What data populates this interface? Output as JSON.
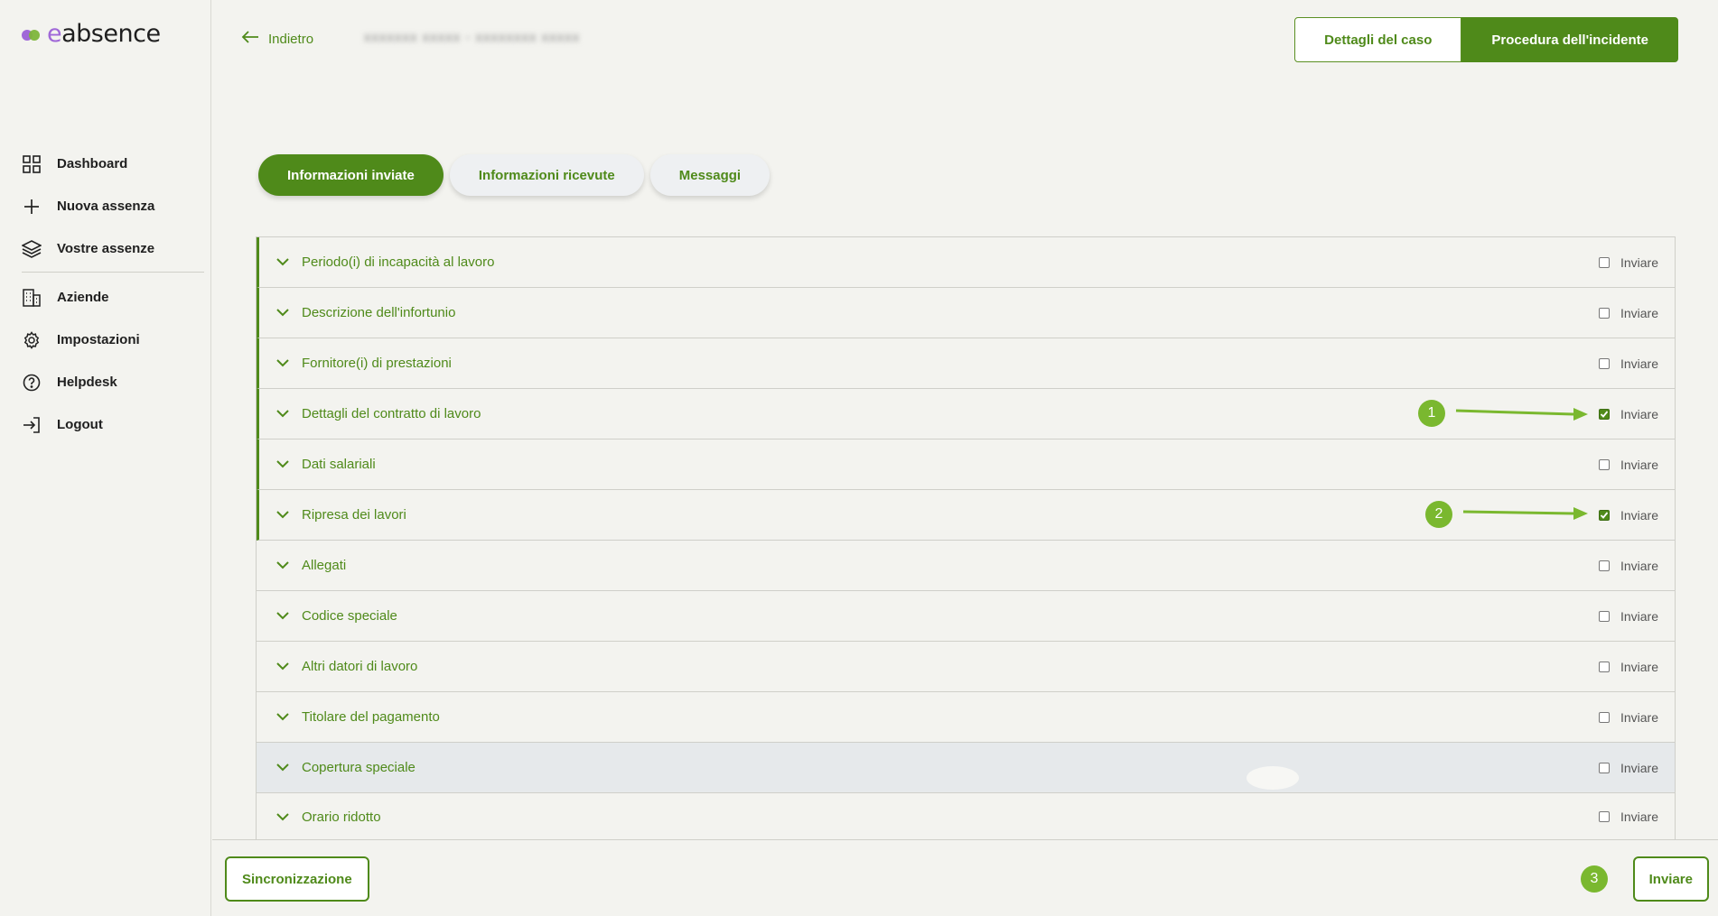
{
  "brand": {
    "name_prefix": "e",
    "name_rest": "absence",
    "accent_green": "#4f8a1a",
    "accent_purple": "#a068d8"
  },
  "sidebar": {
    "items": [
      {
        "label": "Dashboard",
        "icon": "dashboard-grid-icon"
      },
      {
        "label": "Nuova assenza",
        "icon": "plus-icon"
      },
      {
        "label": "Vostre assenze",
        "icon": "layers-icon"
      },
      {
        "label": "Aziende",
        "icon": "building-icon"
      },
      {
        "label": "Impostazioni",
        "icon": "gear-icon"
      },
      {
        "label": "Helpdesk",
        "icon": "help-circle-icon"
      },
      {
        "label": "Logout",
        "icon": "logout-icon"
      }
    ]
  },
  "header": {
    "back_label": "Indietro",
    "case_title": "xxxxxxx xxxxx - xxxxxxxx xxxxx",
    "case_details_label": "Dettagli del caso",
    "incident_procedure_label": "Procedura dell'incidente"
  },
  "tabs": [
    {
      "label": "Informazioni inviate",
      "active": true
    },
    {
      "label": "Informazioni ricevute",
      "active": false
    },
    {
      "label": "Messaggi",
      "active": false
    }
  ],
  "sections": [
    {
      "title": "Periodo(i) di incapacità al lavoro",
      "send_label": "Inviare",
      "checked": false
    },
    {
      "title": "Descrizione dell'infortunio",
      "send_label": "Inviare",
      "checked": false
    },
    {
      "title": "Fornitore(i) di prestazioni",
      "send_label": "Inviare",
      "checked": false
    },
    {
      "title": "Dettagli del contratto di lavoro",
      "send_label": "Inviare",
      "checked": true
    },
    {
      "title": "Dati salariali",
      "send_label": "Inviare",
      "checked": false
    },
    {
      "title": "Ripresa dei lavori",
      "send_label": "Inviare",
      "checked": true
    },
    {
      "title": "Allegati",
      "send_label": "Inviare",
      "checked": false
    },
    {
      "title": "Codice speciale",
      "send_label": "Inviare",
      "checked": false
    },
    {
      "title": "Altri datori di lavoro",
      "send_label": "Inviare",
      "checked": false
    },
    {
      "title": "Titolare del pagamento",
      "send_label": "Inviare",
      "checked": false
    },
    {
      "title": "Copertura speciale",
      "send_label": "Inviare",
      "checked": false
    },
    {
      "title": "Orario ridotto",
      "send_label": "Inviare",
      "checked": false
    }
  ],
  "annotations": {
    "step1": "1",
    "step2": "2",
    "step3": "3"
  },
  "footer": {
    "sync_label": "Sincronizzazione",
    "send_label": "Inviare"
  }
}
